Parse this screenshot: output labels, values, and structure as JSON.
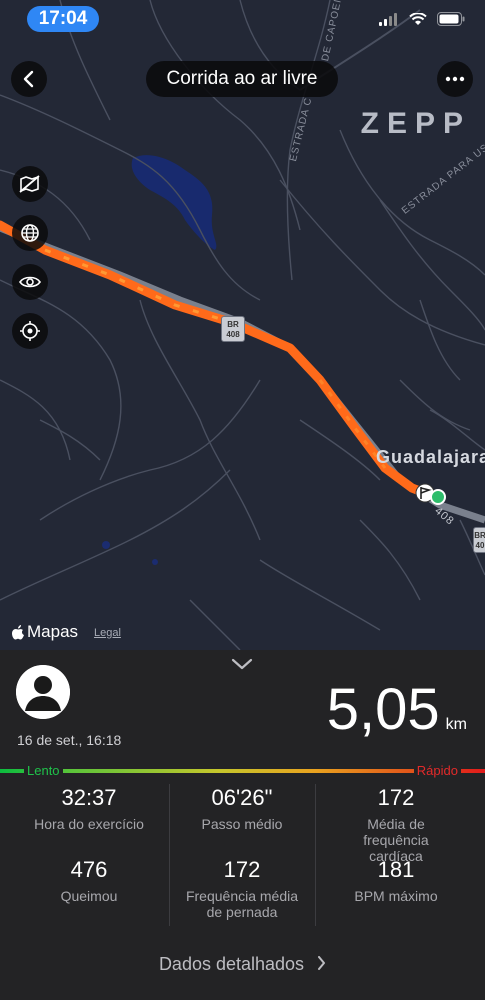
{
  "status_bar": {
    "time": "17:04"
  },
  "map": {
    "title": "Corrida ao ar livre",
    "brand_logo": "ZEPP",
    "road_labels": [
      "ESTRADA C",
      "DE CAPOEIRA",
      "ESTRADA PARA USINA MUSE"
    ],
    "city_label": "Guadalajara",
    "highway_shields": [
      {
        "top": "BR",
        "bottom": "408"
      },
      {
        "top": "BR",
        "bottom": "40"
      }
    ],
    "highway_number_label": "408",
    "attribution": "Mapas",
    "legal_link": "Legal",
    "side_icons": [
      "map-layers-off-icon",
      "globe-icon",
      "eye-icon",
      "locate-icon"
    ]
  },
  "panel": {
    "date": "16 de set., 16:18",
    "distance_value": "5,05",
    "distance_unit": "km",
    "pace_scale": {
      "slow_label": "Lento",
      "fast_label": "Rápido"
    },
    "stats": [
      {
        "value": "32:37",
        "label": "Hora do exercício"
      },
      {
        "value": "06'26\"",
        "label": "Passo médio"
      },
      {
        "value": "172",
        "label": "Média de frequência cardíaca"
      },
      {
        "value": "476",
        "label": "Queimou"
      },
      {
        "value": "172",
        "label": "Frequência média de pernada"
      },
      {
        "value": "181",
        "label": "BPM máximo"
      }
    ],
    "details_link": "Dados detalhados"
  },
  "colors": {
    "accent_blue": "#2f87f5",
    "route_orange": "#ff6a1a",
    "end_marker": "#2ebd6b"
  }
}
